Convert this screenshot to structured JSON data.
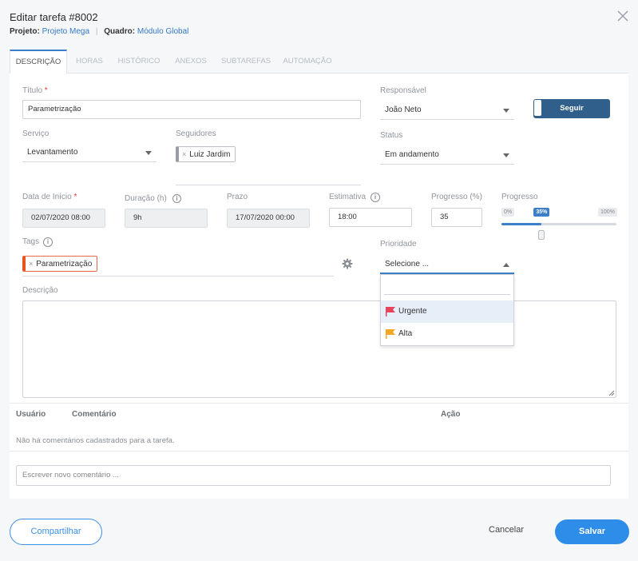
{
  "header": {
    "title": "Editar tarefa #8002",
    "project_label": "Projeto:",
    "project_value": "Projeto Mega",
    "separator": "|",
    "board_label": "Quadro:",
    "board_value": "Módulo Global"
  },
  "tabs": [
    {
      "label": "DESCRIÇÃO",
      "active": true
    },
    {
      "label": "HORAS"
    },
    {
      "label": "HISTÓRICO"
    },
    {
      "label": "ANEXOS"
    },
    {
      "label": "SUBTAREFAS"
    },
    {
      "label": "AUTOMAÇÃO"
    }
  ],
  "form": {
    "title_label": "Título",
    "title_value": "Parametrização",
    "required_mark": "*",
    "responsible_label": "Responsável",
    "responsible_value": "João Neto",
    "follow_label": "Seguir",
    "service_label": "Serviço",
    "service_value": "Levantamento",
    "followers_label": "Seguidores",
    "follower_chip": "Luiz Jardim",
    "status_label": "Status",
    "status_value": "Em andamento",
    "start_label": "Data de Início",
    "start_value": "02/07/2020 08:00",
    "duration_label": "Duração (h)",
    "duration_value": "9h",
    "deadline_label": "Prazo",
    "deadline_value": "17/07/2020 00:00",
    "estimate_label": "Estimativa",
    "estimate_value": "18:00",
    "progress_pct_label": "Progresso (%)",
    "progress_pct_value": "35",
    "progress_label": "Progresso",
    "progress_min": "0%",
    "progress_cur": "35%",
    "progress_max": "100%",
    "progress_fraction": 0.35,
    "tags_label": "Tags",
    "tag_chip": "Parametrização",
    "priority_label": "Prioridade",
    "priority_value": "Selecione ...",
    "priority_options": [
      {
        "label": "Urgente",
        "color": "#e8435a"
      },
      {
        "label": "Alta",
        "color": "#f5a623"
      }
    ],
    "description_label": "Descrição",
    "chip_x": "×",
    "info_glyph": "i"
  },
  "comments": {
    "col_user": "Usuário",
    "col_comment": "Comentário",
    "col_action": "Ação",
    "empty": "Não há comentários cadastrados para a tarefa.",
    "placeholder": "Escrever novo comentário ..."
  },
  "footer": {
    "share": "Compartilhar",
    "cancel": "Cancelar",
    "save": "Salvar"
  },
  "colors": {
    "accent": "#2e8de8",
    "follow": "#2f5f8a",
    "tag_border": "#e8561f"
  }
}
